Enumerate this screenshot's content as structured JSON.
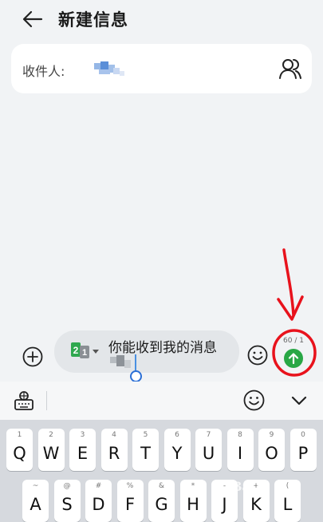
{
  "header": {
    "title": "新建信息"
  },
  "recipient": {
    "label": "收件人:"
  },
  "compose": {
    "sim_primary": "2",
    "sim_secondary": "1",
    "message_text": "你能收到我的消息",
    "counter": "60 / 1"
  },
  "keyboard": {
    "row1": [
      {
        "hint": "1",
        "key": "Q"
      },
      {
        "hint": "2",
        "key": "W"
      },
      {
        "hint": "3",
        "key": "E"
      },
      {
        "hint": "4",
        "key": "R"
      },
      {
        "hint": "5",
        "key": "T"
      },
      {
        "hint": "6",
        "key": "Y"
      },
      {
        "hint": "7",
        "key": "U"
      },
      {
        "hint": "8",
        "key": "I"
      },
      {
        "hint": "9",
        "key": "O"
      },
      {
        "hint": "0",
        "key": "P"
      }
    ],
    "row2": [
      {
        "hint": "~",
        "key": "A"
      },
      {
        "hint": "@",
        "key": "S"
      },
      {
        "hint": "#",
        "key": "D"
      },
      {
        "hint": "%",
        "key": "F"
      },
      {
        "hint": "&",
        "key": "G"
      },
      {
        "hint": "*",
        "key": "H"
      },
      {
        "hint": "-",
        "key": "J"
      },
      {
        "hint": "+",
        "key": "K"
      },
      {
        "hint": "(",
        "key": "L"
      }
    ]
  },
  "colors": {
    "send_button": "#28a745",
    "annotation_red": "#e8121c",
    "cursor_blue": "#2b6fd6"
  },
  "watermark": "Bai百"
}
